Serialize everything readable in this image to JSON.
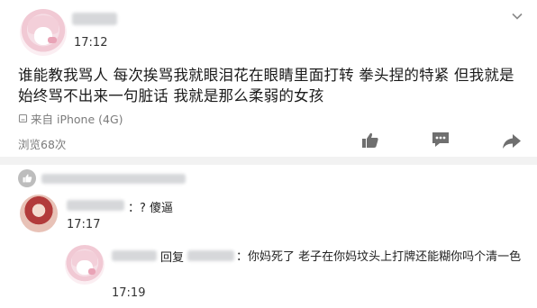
{
  "post": {
    "time": "17:12",
    "content": "谁能教我骂人 每次挨骂我就眼泪花在眼睛里面打转 拳头捏的特紧 但我就是始终骂不出来一句脏话 我就是那么柔弱的女孩",
    "source": "来自 iPhone (4G)",
    "views": "浏览68次"
  },
  "actions": {
    "icons": [
      "thumbs-up-icon",
      "comment-icon",
      "share-icon"
    ]
  },
  "comments": [
    {
      "text": "：? 傻逼",
      "time": "17:17"
    },
    {
      "reply_prefix": "回复",
      "text": "：你妈死了 老子在你妈坟头上打牌还能糊你吗个清一色",
      "time": "17:19"
    }
  ],
  "colors": {
    "text": "#1a1a1a",
    "meta": "#7b7b7b",
    "icon": "#6f6f6f",
    "divider": "#f2f2f2"
  }
}
